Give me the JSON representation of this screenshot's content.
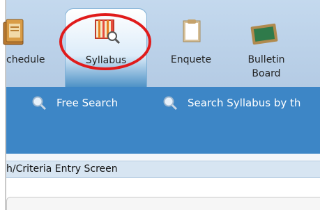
{
  "tabs": [
    {
      "label": "chedule",
      "icon": "schedule-book-icon"
    },
    {
      "label": "Syllabus",
      "icon": "syllabus-board-icon",
      "active": true
    },
    {
      "label": "Enquete",
      "icon": "document-icon"
    },
    {
      "label_line1": "Bulletin",
      "label_line2": "Board",
      "icon": "bulletin-board-icon"
    }
  ],
  "subnav": {
    "free_search": "Free Search",
    "search_syllabus": "Search Syllabus by th"
  },
  "breadcrumb": "h∕Criteria Entry Screen",
  "colors": {
    "nav_bg": "#c4d9ee",
    "subnav_bg": "#3d86c6",
    "crumb_bg": "#d7e5f2",
    "highlight": "#e01b1b"
  }
}
